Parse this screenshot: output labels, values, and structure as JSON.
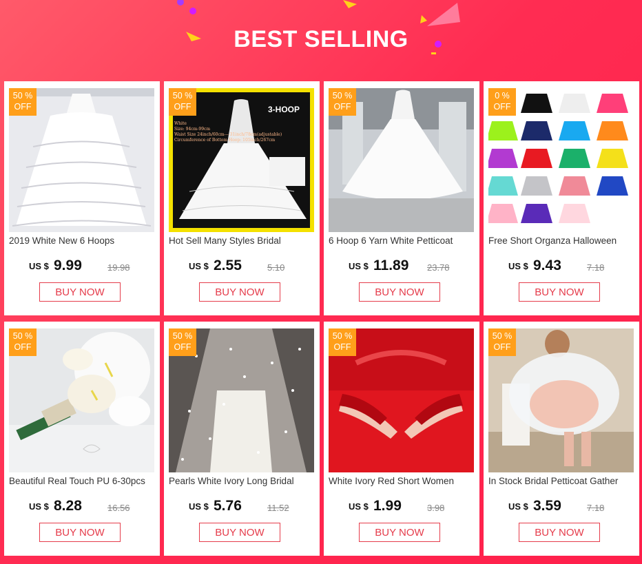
{
  "header": {
    "title": "BEST SELLING"
  },
  "products": [
    {
      "discount": "50 %",
      "off": "OFF",
      "name": "2019 White New 6 Hoops",
      "currency": "US $",
      "price": "9.99",
      "old_price": "19.98",
      "buy_label": "BUY NOW",
      "image": "petticoat-hoops-image"
    },
    {
      "discount": "50 %",
      "off": "OFF",
      "name": "Hot Sell Many Styles Bridal",
      "currency": "US $",
      "price": "2.55",
      "old_price": "5.10",
      "buy_label": "BUY NOW",
      "image": "three-hoop-petticoat-image",
      "image_text": {
        "tag": "3-HOOP",
        "lines": [
          "White",
          "Size:     94cm-99cm",
          "Waist Size  24inch/60cm----31inch/78cm(adjustable)",
          "Circumference of Bottom Hoop: 105inch/267cm"
        ]
      }
    },
    {
      "discount": "50 %",
      "off": "OFF",
      "name": "6 Hoop 6 Yarn White Petticoat",
      "currency": "US $",
      "price": "11.89",
      "old_price": "23.78",
      "buy_label": "BUY NOW",
      "image": "mannequin-petticoat-image"
    },
    {
      "discount": "0 %",
      "off": "OFF",
      "name": "Free Short Organza Halloween",
      "currency": "US $",
      "price": "9.43",
      "old_price": "7.18",
      "buy_label": "BUY NOW",
      "image": "colored-tutus-grid-image"
    },
    {
      "discount": "50 %",
      "off": "OFF",
      "name": "Beautiful Real Touch PU 6-30pcs",
      "currency": "US $",
      "price": "8.28",
      "old_price": "16.56",
      "buy_label": "BUY NOW",
      "image": "calla-lily-bouquet-image"
    },
    {
      "discount": "50 %",
      "off": "OFF",
      "name": "Pearls White Ivory Long Bridal",
      "currency": "US $",
      "price": "5.76",
      "old_price": "11.52",
      "buy_label": "BUY NOW",
      "image": "pearl-veil-image"
    },
    {
      "discount": "50 %",
      "off": "OFF",
      "name": "White Ivory Red Short Women",
      "currency": "US $",
      "price": "1.99",
      "old_price": "3.98",
      "buy_label": "BUY NOW",
      "image": "red-lace-gloves-image"
    },
    {
      "discount": "50 %",
      "off": "OFF",
      "name": "In Stock Bridal Petticoat Gather",
      "currency": "US $",
      "price": "3.59",
      "old_price": "7.18",
      "buy_label": "BUY NOW",
      "image": "petticoat-gather-image"
    }
  ],
  "colors": {
    "badge": "#ff9f1a",
    "accent": "#e53b4a",
    "background": "#ff2c52"
  }
}
